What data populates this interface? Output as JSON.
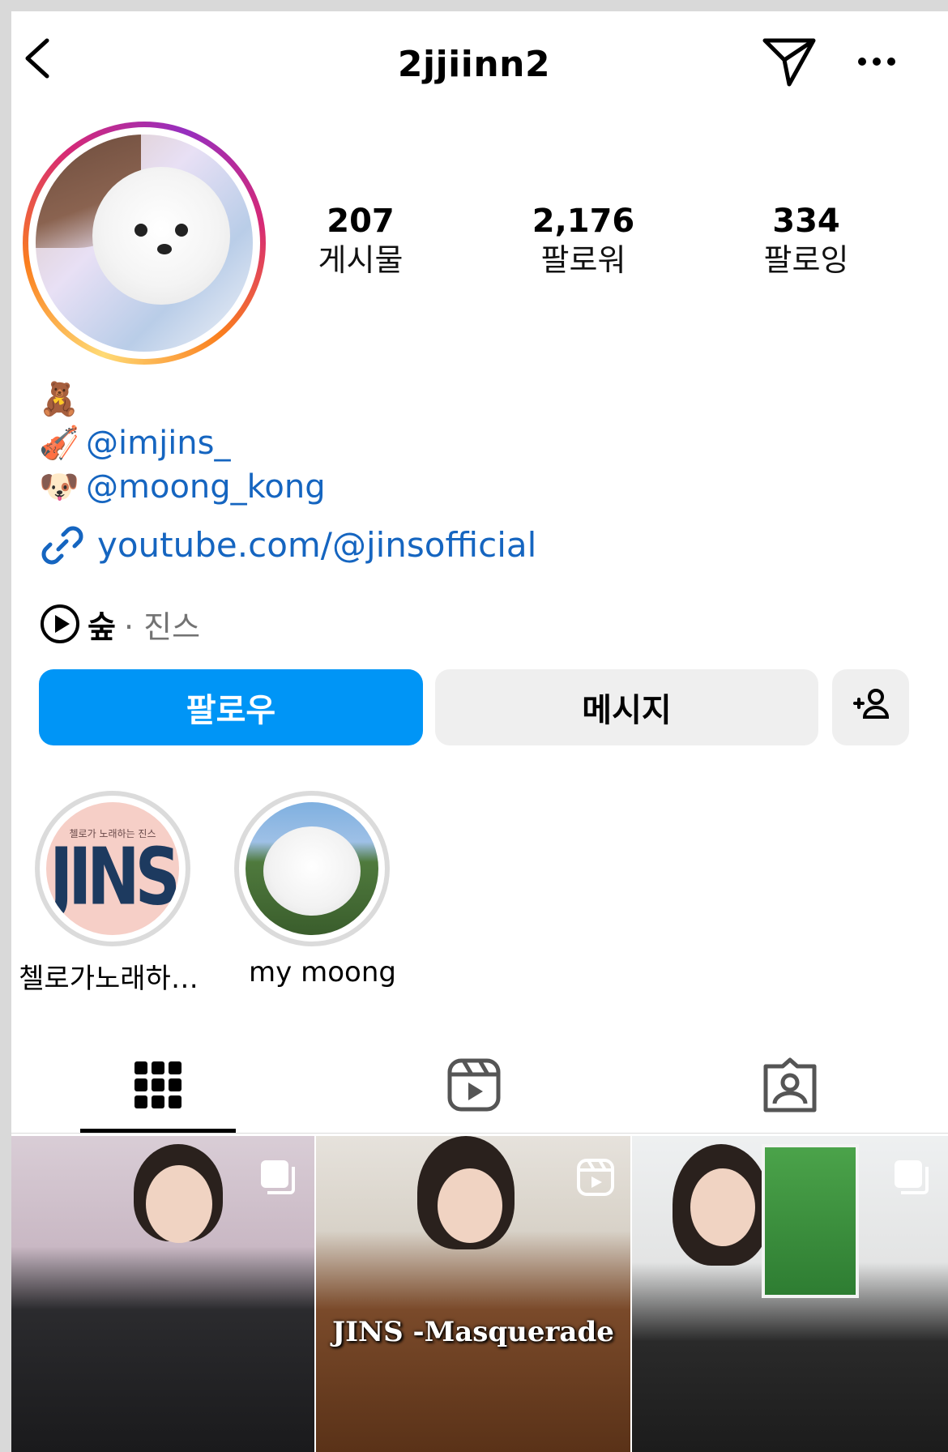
{
  "header": {
    "username": "2jjiinn2",
    "back_icon": "chevron-left-icon",
    "send_icon": "paper-plane-icon",
    "more_icon": "more-horizontal-icon"
  },
  "stats": [
    {
      "value": "207",
      "label": "게시물"
    },
    {
      "value": "2,176",
      "label": "팔로워"
    },
    {
      "value": "334",
      "label": "팔로잉"
    }
  ],
  "bio": {
    "line1_emoji": "🧸",
    "line2_emoji": "🎻",
    "line2_link": "@imjins_",
    "line3_emoji": "🐶",
    "line3_link": "@moong_kong",
    "website": "youtube.com/@jinsofficial"
  },
  "music": {
    "title": "숲",
    "artist": "· 진스"
  },
  "buttons": {
    "follow": "팔로우",
    "message": "메시지",
    "add_icon": "add-person-icon"
  },
  "highlights": [
    {
      "label": "첼로가노래하…",
      "cover_top": "첼로가 노래하는 진스",
      "cover_big": "JINS"
    },
    {
      "label": "my moong"
    }
  ],
  "tabs": [
    "grid-icon",
    "reels-icon",
    "tagged-icon"
  ],
  "grid": [
    {
      "badge": "multi-photo-icon",
      "overlay": ""
    },
    {
      "badge": "reels-icon",
      "overlay": "JINS -Masquerade"
    },
    {
      "badge": "multi-photo-icon",
      "overlay": ""
    }
  ],
  "colors": {
    "follow_button": "#0095f6",
    "secondary_button": "#efefef",
    "link": "#1565c0",
    "muted": "#737373"
  }
}
